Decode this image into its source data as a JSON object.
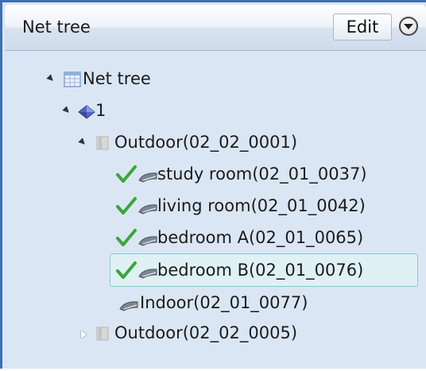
{
  "header": {
    "title": "Net tree",
    "edit_label": "Edit",
    "menu_icon": "chevron-down-circle-icon"
  },
  "tree": {
    "root": {
      "label": "Net tree",
      "expanded": true,
      "icon": "table-icon"
    },
    "network": {
      "label": "1",
      "expanded": true,
      "icon": "network-diamond-icon"
    },
    "outdoor_1": {
      "label": "Outdoor(02_02_0001)",
      "expanded": true,
      "icon": "outdoor-unit-icon",
      "children": [
        {
          "label": "study room(02_01_0037)",
          "status_icon": "checkmark-icon",
          "icon": "indoor-unit-icon",
          "selected": false
        },
        {
          "label": "living room(02_01_0042)",
          "status_icon": "checkmark-icon",
          "icon": "indoor-unit-icon",
          "selected": false
        },
        {
          "label": "bedroom A(02_01_0065)",
          "status_icon": "checkmark-icon",
          "icon": "indoor-unit-icon",
          "selected": false
        },
        {
          "label": "bedroom B(02_01_0076)",
          "status_icon": "checkmark-icon",
          "icon": "indoor-unit-icon",
          "selected": true
        }
      ]
    },
    "indoor_standalone": {
      "label": "Indoor(02_01_0077)",
      "icon": "indoor-unit-icon"
    },
    "outdoor_2": {
      "label": "Outdoor(02_02_0005)",
      "expanded": false,
      "icon": "outdoor-unit-icon"
    }
  },
  "colors": {
    "panel_bg": "#dbe6f4",
    "border": "#3f6fb0",
    "selected_bg": "#dff1f5",
    "selected_border": "#8ec4d6",
    "check": "#3aa63a"
  }
}
